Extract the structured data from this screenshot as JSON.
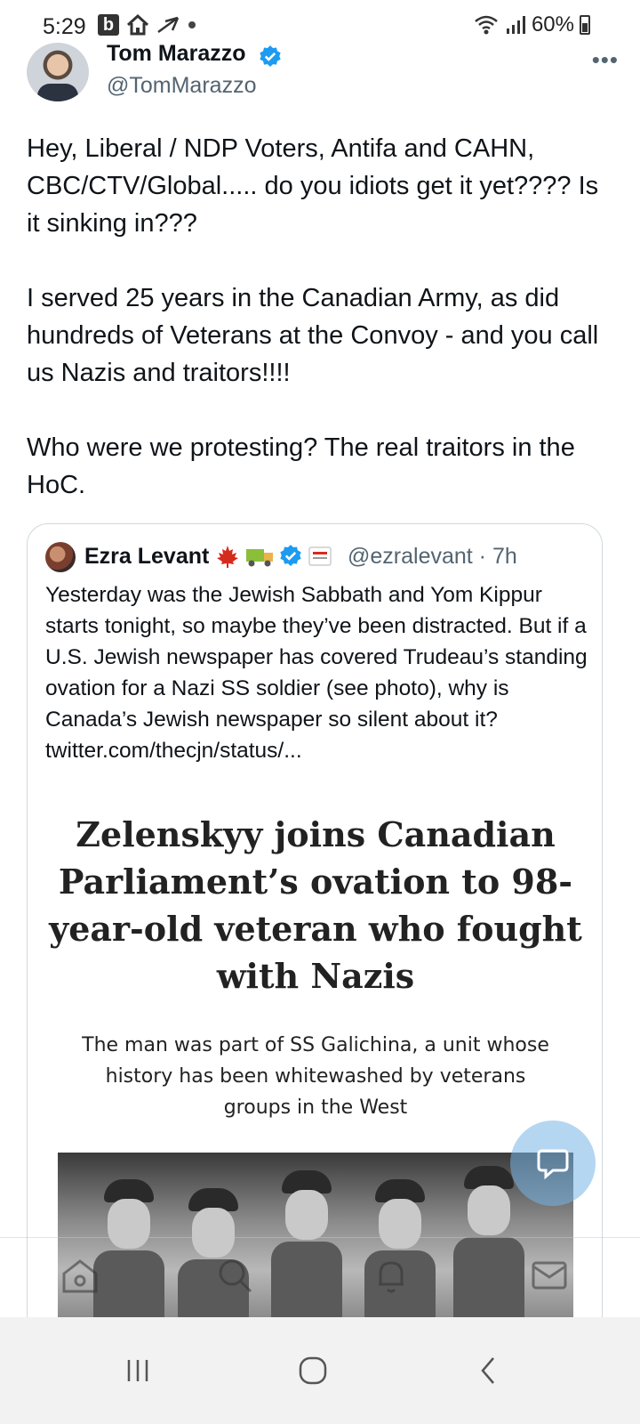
{
  "status_bar": {
    "time": "5:29",
    "b_icon_letter": "b",
    "battery": "60%",
    "icons": [
      "home-icon",
      "send-icon",
      "wifi-icon",
      "signal-icon",
      "battery-icon"
    ]
  },
  "tweet": {
    "author_name": "Tom Marazzo",
    "author_handle": "@TomMarazzo",
    "more": "•••",
    "paragraphs": [
      "Hey, Liberal / NDP Voters, Antifa and CAHN, CBC/CTV/Global..... do you idiots get it yet???? Is it sinking in???",
      "I served 25 years in the Canadian Army, as did hundreds of Veterans at the Convoy - and you call us Nazis and traitors!!!!",
      "Who were we protesting?  The real traitors in the HoC."
    ]
  },
  "quote": {
    "author_name": "Ezra Levant",
    "handle_meta": "@ezralevant · 7h",
    "text": "Yesterday was the Jewish Sabbath and Yom Kippur starts tonight, so maybe they’ve been distracted. But if a U.S. Jewish newspaper has covered Trudeau’s standing ovation for a Nazi SS soldier (see photo), why is Canada’s Jewish newspaper so silent about it?  twitter.com/thecjn/status/...",
    "headline": "Zelenskyy joins Canadian Parliament’s ovation to 98-year-old veteran who fought with Nazis",
    "subhead": "The man was part of SS Galichina, a unit whose history has been whitewashed by veterans groups in the West"
  },
  "colors": {
    "accent": "#1d9bf0",
    "text_primary": "#0f1419",
    "text_secondary": "#536471"
  }
}
